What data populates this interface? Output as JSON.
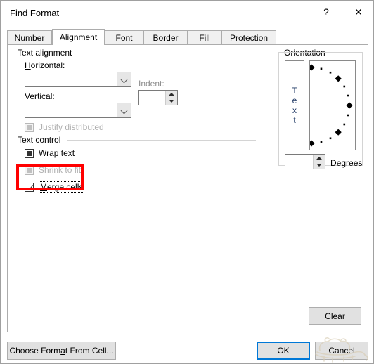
{
  "window": {
    "title": "Find Format",
    "help_button": "?",
    "close_button": "✕"
  },
  "tabs": [
    {
      "label": "Number",
      "active": false
    },
    {
      "label": "Alignment",
      "active": true
    },
    {
      "label": "Font",
      "active": false
    },
    {
      "label": "Border",
      "active": false
    },
    {
      "label": "Fill",
      "active": false
    },
    {
      "label": "Protection",
      "active": false
    }
  ],
  "text_alignment": {
    "group_label": "Text alignment",
    "horizontal": {
      "label_prefix": "",
      "label_accel": "H",
      "label_suffix": "orizontal:",
      "value": "",
      "enabled": true
    },
    "vertical": {
      "label_prefix": "",
      "label_accel": "V",
      "label_suffix": "ertical:",
      "value": "",
      "enabled": true
    },
    "indent": {
      "label": "Indent:",
      "value": "",
      "enabled": false
    },
    "justify_distributed": {
      "label": "Justify distributed",
      "state": "indeterminate",
      "enabled": false
    }
  },
  "text_control": {
    "group_label": "Text control",
    "items": [
      {
        "label_prefix": "",
        "label_accel": "W",
        "label_suffix": "rap text",
        "state": "indeterminate",
        "enabled": true,
        "focused": false
      },
      {
        "label_prefix": "S",
        "label_accel": "h",
        "label_suffix": "rink to fit",
        "state": "indeterminate",
        "enabled": false,
        "focused": false
      },
      {
        "label_prefix": "",
        "label_accel": "M",
        "label_suffix": "erge cells",
        "state": "checked",
        "enabled": true,
        "focused": true
      }
    ]
  },
  "orientation": {
    "group_label": "Orientation",
    "text_sample": [
      "T",
      "e",
      "x",
      "t"
    ],
    "degrees": {
      "value": "",
      "label_accel": "D",
      "label_suffix": "egrees"
    },
    "dial_markers_deg": [
      90,
      45,
      0,
      -45,
      -90
    ],
    "dial_dots_deg": [
      75,
      60,
      30,
      15,
      -15,
      -30,
      -60,
      -75
    ]
  },
  "buttons": {
    "clear": {
      "label_prefix": "Clea",
      "label_accel": "r",
      "label_suffix": ""
    },
    "choose_format": {
      "label_prefix": "Choose Form",
      "label_accel": "a",
      "label_suffix": "t From Cell..."
    },
    "ok": {
      "label": "OK",
      "default": true
    },
    "cancel": {
      "label": "Cancel",
      "default": false
    }
  },
  "annotation": {
    "highlight_color": "#ff0000",
    "target": "merge-cells-checkbox"
  },
  "colors": {
    "accent": "#0078d7",
    "dialog_bg": "#ffffff",
    "button_face": "#e1e1e1",
    "group_border": "#d4d4d4",
    "disabled_text": "#b0b0b0",
    "orientation_text": "#1f3864"
  }
}
